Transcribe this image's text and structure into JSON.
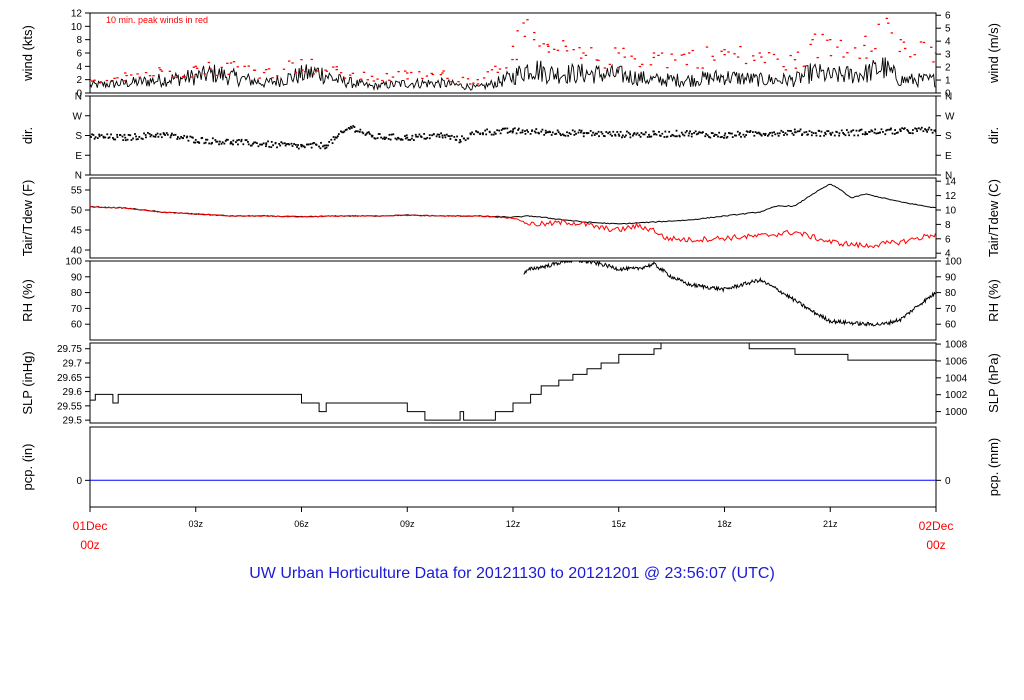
{
  "title": "UW Urban Horticulture Data for 20121130  to  20121201 @ 23:56:07  (UTC)",
  "colors": {
    "main": "#000000",
    "peak": "#ff0000",
    "dewpoint": "#ff0000",
    "precip": "#0000ff",
    "title": "#1b1bd6",
    "endpoint_label": "#ff0000"
  },
  "chart_data": {
    "type": "line",
    "x_axis": {
      "unit": "hours UTC",
      "range": [
        0,
        24
      ],
      "ticks": [
        {
          "x": 0,
          "label": "01Dec",
          "label2": "00z",
          "endpoint": true
        },
        {
          "x": 3,
          "label": "03z"
        },
        {
          "x": 6,
          "label": "06z"
        },
        {
          "x": 9,
          "label": "09z"
        },
        {
          "x": 12,
          "label": "12z"
        },
        {
          "x": 15,
          "label": "15z"
        },
        {
          "x": 18,
          "label": "18z"
        },
        {
          "x": 21,
          "label": "21z"
        },
        {
          "x": 24,
          "label": "02Dec",
          "label2": "00z",
          "endpoint": true
        }
      ]
    },
    "panels": [
      {
        "id": "wind",
        "ylabel_left": "wind (kts)",
        "ylabel_right": "wind (m/s)",
        "annotation": "10 min. peak winds in red",
        "ylim": [
          0,
          12
        ],
        "left_ticks": [
          0,
          2,
          4,
          6,
          8,
          10,
          12
        ],
        "right_ticks": [
          0,
          1,
          2,
          3,
          4,
          5,
          6
        ],
        "right_scale": 0.5144,
        "series": [
          {
            "kind": "line",
            "x": [
              0,
              1,
              2,
              3,
              3.5,
              4,
              5,
              6,
              6.5,
              7,
              8,
              9,
              10,
              11,
              11.5,
              12,
              12.5,
              13,
              14,
              15,
              16,
              17,
              18,
              19,
              20,
              20.5,
              21,
              22,
              22.5,
              23,
              24
            ],
            "y": [
              1.2,
              1.5,
              2,
              2.5,
              3,
              2.5,
              1.5,
              2.8,
              3.2,
              2,
              1,
              1.5,
              1.5,
              0.8,
              1.5,
              2.5,
              4,
              3,
              3,
              2.8,
              2,
              2,
              2.5,
              2,
              2,
              3.2,
              2.6,
              3,
              4,
              2,
              2
            ]
          },
          {
            "kind": "points",
            "color": "peak",
            "x": [
              0,
              1,
              2,
              3,
              4,
              5,
              6,
              7,
              8,
              9,
              10,
              11,
              11.5,
              12,
              12.3,
              12.6,
              13,
              13.5,
              14,
              15,
              16,
              17,
              18,
              19,
              20,
              20.5,
              21,
              22,
              22.5,
              23,
              24
            ],
            "y": [
              2,
              3,
              3.5,
              4,
              4.5,
              3.5,
              5,
              3.5,
              2.5,
              3,
              3,
              2,
              4,
              7,
              10.5,
              8,
              7,
              7,
              6,
              6,
              6,
              6,
              6.5,
              6,
              5,
              8,
              8,
              8.5,
              12,
              8,
              6
            ]
          }
        ]
      },
      {
        "id": "dir",
        "ylabel_left": "dir.",
        "ylabel_right": "dir.",
        "ylim": [
          0,
          360
        ],
        "left_ticks": [
          {
            "v": 0,
            "label": "N"
          },
          {
            "v": 90,
            "label": "E"
          },
          {
            "v": 180,
            "label": "S"
          },
          {
            "v": 270,
            "label": "W"
          },
          {
            "v": 360,
            "label": "N"
          }
        ],
        "right_ticks": [
          {
            "v": 0,
            "label": "N"
          },
          {
            "v": 90,
            "label": "E"
          },
          {
            "v": 180,
            "label": "S"
          },
          {
            "v": 270,
            "label": "W"
          },
          {
            "v": 360,
            "label": "N"
          }
        ],
        "series": [
          {
            "kind": "points",
            "x": [
              0,
              1,
              2,
              3,
              4,
              5,
              6,
              6.7,
              7,
              7.4,
              8,
              9,
              10,
              10.5,
              11,
              12,
              13,
              14,
              15,
              16,
              17,
              18,
              19,
              20,
              21,
              22,
              23,
              24
            ],
            "y": [
              175,
              170,
              185,
              160,
              150,
              140,
              130,
              135,
              170,
              220,
              175,
              170,
              180,
              160,
              195,
              200,
              195,
              190,
              185,
              185,
              190,
              180,
              190,
              195,
              190,
              195,
              200,
              205
            ]
          }
        ]
      },
      {
        "id": "temp",
        "ylabel_left": "Tair/Tdew (F)",
        "ylabel_right": "Tair/Tdew (C)",
        "ylim": [
          38,
          58
        ],
        "left_ticks": [
          40,
          45,
          50,
          55
        ],
        "right_ticks": [
          4,
          6,
          8,
          10,
          12,
          14
        ],
        "right_scale": "c_to_f",
        "series": [
          {
            "kind": "line",
            "name": "Tair",
            "x": [
              0,
              1,
              2,
              3,
              4,
              5,
              6,
              7,
              8,
              9,
              10,
              11,
              12,
              12.5,
              13,
              13.5,
              14,
              15,
              16,
              17,
              18,
              19,
              19.5,
              20,
              20.5,
              21,
              21.3,
              21.6,
              22,
              23,
              24
            ],
            "y": [
              50.8,
              50.5,
              49.5,
              49,
              48.5,
              48.5,
              48.3,
              48.5,
              48.5,
              48.7,
              48.5,
              48.5,
              48.2,
              48.5,
              48,
              47.5,
              47,
              46.5,
              47,
              47.5,
              48.5,
              49.5,
              51,
              51,
              54,
              56.5,
              55,
              53,
              54,
              52,
              50.5
            ]
          },
          {
            "kind": "line",
            "name": "Tdew",
            "color": "dewpoint",
            "x": [
              0,
              1,
              2,
              3,
              4,
              5,
              6,
              7,
              8,
              9,
              10,
              11,
              12,
              12.5,
              13,
              13.5,
              14,
              14.5,
              15,
              15.5,
              16,
              16.3,
              17,
              18,
              19,
              20,
              21,
              22,
              23,
              24
            ],
            "y": [
              50.8,
              50.5,
              49.5,
              49,
              48.5,
              48.5,
              48.3,
              48.5,
              48.5,
              48.7,
              48.5,
              48.5,
              48,
              46.5,
              46.5,
              47,
              46.5,
              45.5,
              45,
              46,
              45,
              43,
              42.5,
              43,
              43.5,
              44.5,
              42,
              41,
              42,
              44
            ]
          }
        ]
      },
      {
        "id": "rh",
        "ylabel_left": "RH (%)",
        "ylabel_right": "RH (%)",
        "ylim": [
          50,
          100
        ],
        "left_ticks": [
          60,
          70,
          80,
          90,
          100
        ],
        "right_ticks": [
          60,
          70,
          80,
          90,
          100
        ],
        "series": [
          {
            "kind": "line",
            "x": [
              12.3,
              12.5,
              13,
              13.5,
              14,
              14.5,
              15,
              15.5,
              16,
              16.5,
              17,
              18,
              18.5,
              19,
              19.5,
              20,
              20.5,
              21,
              22,
              22.5,
              23,
              23.5,
              24
            ],
            "y": [
              92,
              95,
              97,
              100,
              100,
              98,
              95,
              95,
              98,
              90,
              85,
              82,
              85,
              88,
              82,
              75,
              68,
              62,
              60,
              60,
              63,
              72,
              80
            ]
          }
        ]
      },
      {
        "id": "slp",
        "ylabel_left": "SLP (inHg)",
        "ylabel_right": "SLP (hPa)",
        "ylim": [
          29.49,
          29.77
        ],
        "left_ticks": [
          29.5,
          29.55,
          29.6,
          29.65,
          29.7,
          29.75
        ],
        "right_ticks": [
          1000,
          1002,
          1004,
          1006,
          1008
        ],
        "right_scale": "hpa_to_inhg",
        "series": [
          {
            "kind": "step",
            "x": [
              0,
              0.15,
              0.3,
              0.6,
              0.65,
              0.8,
              5.2,
              6.0,
              6.5,
              6.7,
              8.3,
              9.0,
              9.5,
              10.5,
              10.6,
              11.5,
              12.0,
              12.5,
              12.8,
              13.3,
              13.7,
              14.1,
              14.5,
              15.0,
              16.0,
              16.2,
              17.0,
              18.7,
              20.0,
              21.5,
              23.0,
              24.0
            ],
            "y": [
              29.57,
              29.59,
              29.59,
              29.59,
              29.56,
              29.59,
              29.59,
              29.56,
              29.53,
              29.56,
              29.56,
              29.53,
              29.5,
              29.53,
              29.5,
              29.53,
              29.56,
              29.59,
              29.62,
              29.64,
              29.66,
              29.68,
              29.7,
              29.73,
              29.75,
              29.77,
              29.77,
              29.75,
              29.73,
              29.71,
              29.71,
              29.73
            ]
          }
        ]
      },
      {
        "id": "pcp",
        "ylabel_left": "pcp. (in)",
        "ylabel_right": "pcp. (mm)",
        "ylim": [
          -0.5,
          1
        ],
        "left_ticks": [
          0
        ],
        "right_ticks": [
          0
        ],
        "series": [
          {
            "kind": "line",
            "color": "precip",
            "x": [
              0,
              24
            ],
            "y": [
              0,
              0
            ]
          }
        ]
      }
    ]
  }
}
